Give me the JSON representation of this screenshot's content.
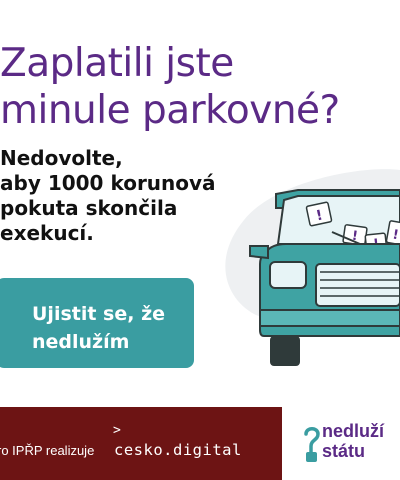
{
  "headline": {
    "line1": "Zaplatili jste",
    "line2": "minule parkovné?"
  },
  "lede": {
    "line1": "Nedovolte,",
    "line2": "aby 1000 korunová",
    "line3": "pokuta skončila",
    "line4": "exekucí."
  },
  "illustration": {
    "icon": "car-with-fine-tickets",
    "ticket_marks": [
      "!",
      "!",
      "!",
      "!"
    ]
  },
  "cta": {
    "line1": "Ujistit se, že",
    "line2": "nedlužím"
  },
  "footer": {
    "credit": "ro IPŘP realizuje",
    "partner_logo_chevron": ">",
    "partner_logo_text": "cesko.digital",
    "brand_line1": "nedluží",
    "brand_line2": "státu"
  },
  "colors": {
    "brand_purple": "#5b2a86",
    "cta_teal": "#3a9da1",
    "car_teal": "#3fa3a3",
    "footer_maroon": "#6d1414"
  }
}
